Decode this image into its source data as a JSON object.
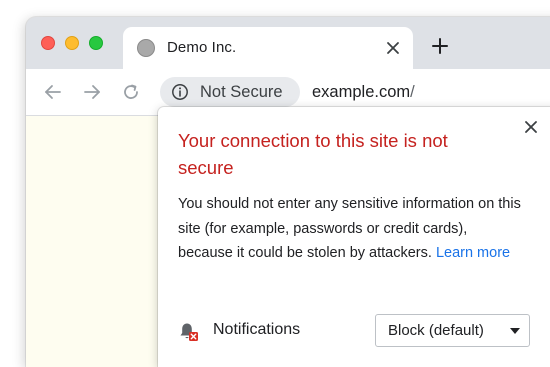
{
  "window": {
    "traffic_lights": [
      "close",
      "minimize",
      "maximize"
    ]
  },
  "tab": {
    "title": "Demo Inc.",
    "favicon_icon": "generic-globe-icon",
    "close_icon": "close-icon"
  },
  "new_tab_icon": "plus-icon",
  "toolbar": {
    "back_icon": "arrow-left-icon",
    "forward_icon": "arrow-right-icon",
    "reload_icon": "reload-icon",
    "security_icon": "info-icon",
    "security_label": "Not Secure",
    "url_host": "example.com",
    "url_path": "/"
  },
  "popup": {
    "title": "Your connection to this site is not secure",
    "body": "You should not enter any sensitive information on this site (for example, passwords or credit cards), because it could be stolen by attackers.",
    "learn_more": "Learn more",
    "close_icon": "close-icon",
    "permission": {
      "icon": "notifications-blocked-icon",
      "label": "Notifications",
      "selected": "Block (default)"
    }
  },
  "colors": {
    "title_red": "#c5221f",
    "link_blue": "#1a73e8",
    "page_background": "#fefdf0",
    "chrome_frame": "#dee1e6"
  }
}
